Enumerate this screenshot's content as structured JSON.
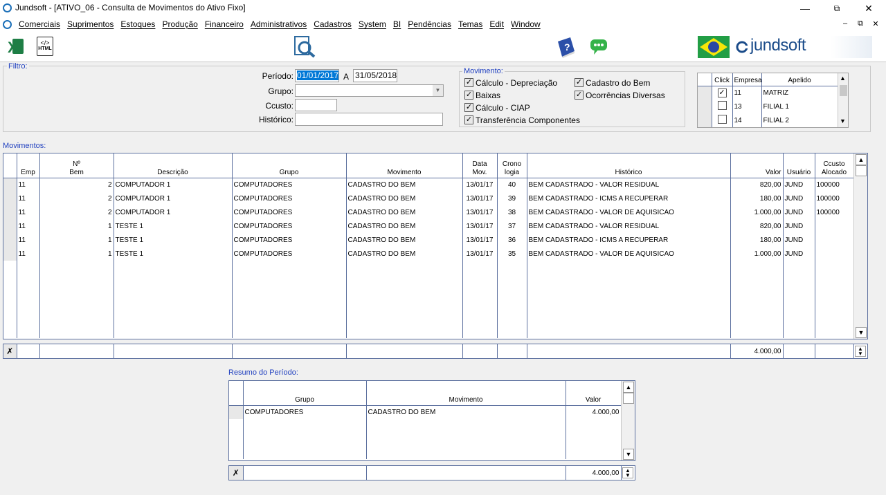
{
  "window": {
    "title": "Jundsoft - [ATIVO_06 - Consulta de Movimentos do Ativo Fixo]"
  },
  "menu": [
    "Comerciais",
    "Suprimentos",
    "Estoques",
    "Produção",
    "Financeiro",
    "Administrativos",
    "Cadastros",
    "System",
    "BI",
    "Pendências",
    "Temas",
    "Edit",
    "Window"
  ],
  "toolbar": {
    "excel_label": "X",
    "html_label": "HTML",
    "brand": "jundsoft"
  },
  "filtro": {
    "legend": "Filtro:",
    "periodo_label": "Período:",
    "periodo_from": "01/01/2017",
    "periodo_sep": "A",
    "periodo_to": "31/05/2018",
    "grupo_label": "Grupo:",
    "grupo_value": "",
    "ccusto_label": "Ccusto:",
    "ccusto_value": "",
    "historico_label": "Histórico:",
    "historico_value": ""
  },
  "movimento": {
    "legend": "Movimento:",
    "options": [
      {
        "label": "Cálculo - Depreciação",
        "checked": true
      },
      {
        "label": "Baixas",
        "checked": true
      },
      {
        "label": "Cálculo - CIAP",
        "checked": true
      },
      {
        "label": "Transferência Componentes",
        "checked": true
      },
      {
        "label": "Cadastro do Bem",
        "checked": true
      },
      {
        "label": "Ocorrências Diversas",
        "checked": true
      }
    ]
  },
  "empresas": {
    "headers": [
      "Click",
      "Empresa",
      "Apelido"
    ],
    "rows": [
      {
        "checked": true,
        "empresa": "11",
        "apelido": "MATRIZ"
      },
      {
        "checked": false,
        "empresa": "13",
        "apelido": "FILIAL 1"
      },
      {
        "checked": false,
        "empresa": "14",
        "apelido": "FILIAL 2"
      }
    ]
  },
  "movimentos": {
    "legend": "Movimentos:",
    "headers": [
      "Emp",
      "Nº\nBem",
      "Descrição",
      "Grupo",
      "Movimento",
      "Data\nMov.",
      "Crono\nlogia",
      "Histórico",
      "Valor",
      "Usuário",
      "Ccusto\nAlocado"
    ],
    "rows": [
      [
        "11",
        "2",
        "COMPUTADOR 1",
        "COMPUTADORES",
        "CADASTRO DO BEM",
        "13/01/17",
        "40",
        "BEM CADASTRADO - VALOR RESIDUAL",
        "820,00",
        "JUND",
        "100000"
      ],
      [
        "11",
        "2",
        "COMPUTADOR 1",
        "COMPUTADORES",
        "CADASTRO DO BEM",
        "13/01/17",
        "39",
        "BEM CADASTRADO - ICMS A RECUPERAR",
        "180,00",
        "JUND",
        "100000"
      ],
      [
        "11",
        "2",
        "COMPUTADOR 1",
        "COMPUTADORES",
        "CADASTRO DO BEM",
        "13/01/17",
        "38",
        "BEM CADASTRADO - VALOR DE AQUISICAO",
        "1.000,00",
        "JUND",
        "100000"
      ],
      [
        "11",
        "1",
        "TESTE 1",
        "COMPUTADORES",
        "CADASTRO DO BEM",
        "13/01/17",
        "37",
        "BEM CADASTRADO - VALOR RESIDUAL",
        "820,00",
        "JUND",
        ""
      ],
      [
        "11",
        "1",
        "TESTE 1",
        "COMPUTADORES",
        "CADASTRO DO BEM",
        "13/01/17",
        "36",
        "BEM CADASTRADO - ICMS A RECUPERAR",
        "180,00",
        "JUND",
        ""
      ],
      [
        "11",
        "1",
        "TESTE 1",
        "COMPUTADORES",
        "CADASTRO DO BEM",
        "13/01/17",
        "35",
        "BEM CADASTRADO - VALOR DE AQUISICAO",
        "1.000,00",
        "JUND",
        ""
      ]
    ],
    "total_valor": "4.000,00"
  },
  "resumo": {
    "legend": "Resumo do Período:",
    "headers": [
      "Grupo",
      "Movimento",
      "Valor"
    ],
    "rows": [
      [
        "COMPUTADORES",
        "CADASTRO DO BEM",
        "4.000,00"
      ]
    ],
    "total_valor": "4.000,00"
  },
  "colors": {
    "accent": "#1f3fbf",
    "grid_line": "#5b6f9e",
    "selection": "#0078d7"
  }
}
